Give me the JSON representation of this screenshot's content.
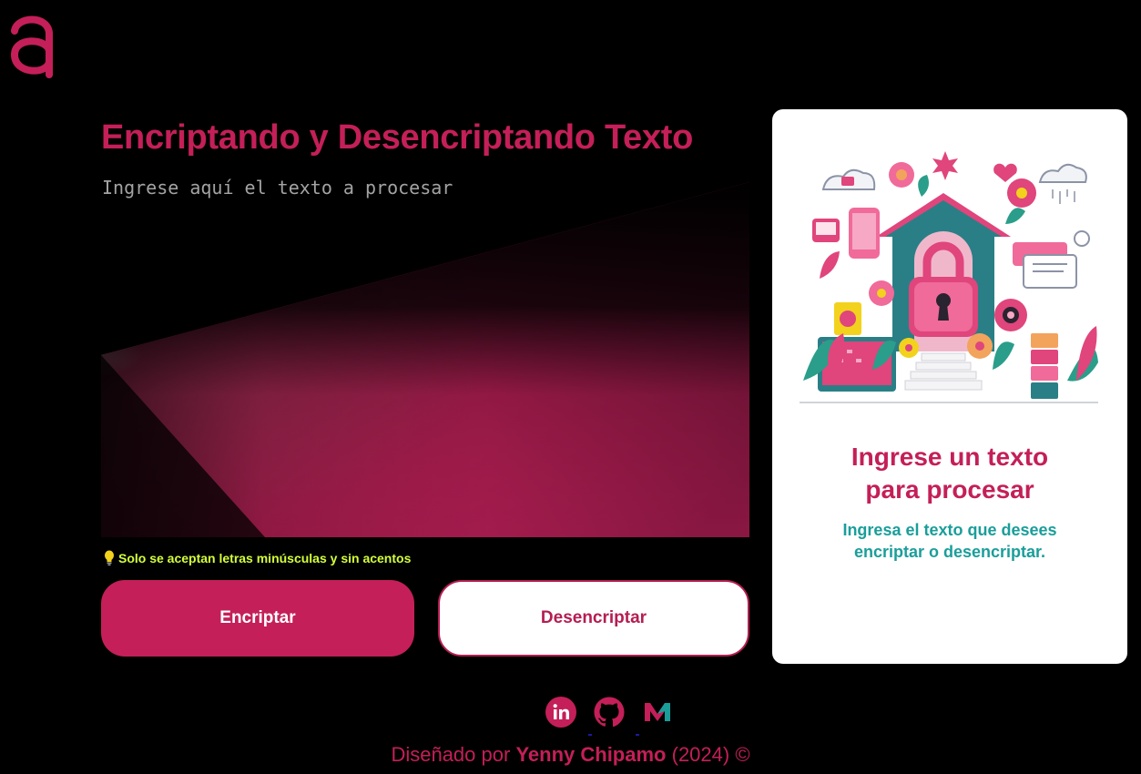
{
  "logo": {
    "icon": "a-letter-logo-icon",
    "color": "#c41f58"
  },
  "main": {
    "title": "Encriptando y Desencriptando Texto",
    "input_placeholder": "Ingrese aquí el texto a procesar",
    "input_value": "",
    "hint_icon": "lightbulb-icon",
    "hint_text": "Solo se aceptan letras minúsculas y sin acentos",
    "encrypt_label": "Encriptar",
    "decrypt_label": "Desencriptar"
  },
  "card": {
    "illustration": "padlock-house-flowers-illustration",
    "title_line1": "Ingrese un texto",
    "title_line2": "para procesar",
    "sub_line1": "Ingresa el texto que desees",
    "sub_line2": "encriptar o desencriptar."
  },
  "footer": {
    "socials": [
      "linkedin-icon",
      "github-icon",
      "medium-m-icon"
    ],
    "prefix": "Diseñado por",
    "author": "Yenny Chipamo",
    "suffix": "(2024) ©"
  },
  "colors": {
    "accent": "#c41f58",
    "background": "#000000",
    "hint": "#d4ff3a",
    "teal": "#1a9e9a"
  }
}
